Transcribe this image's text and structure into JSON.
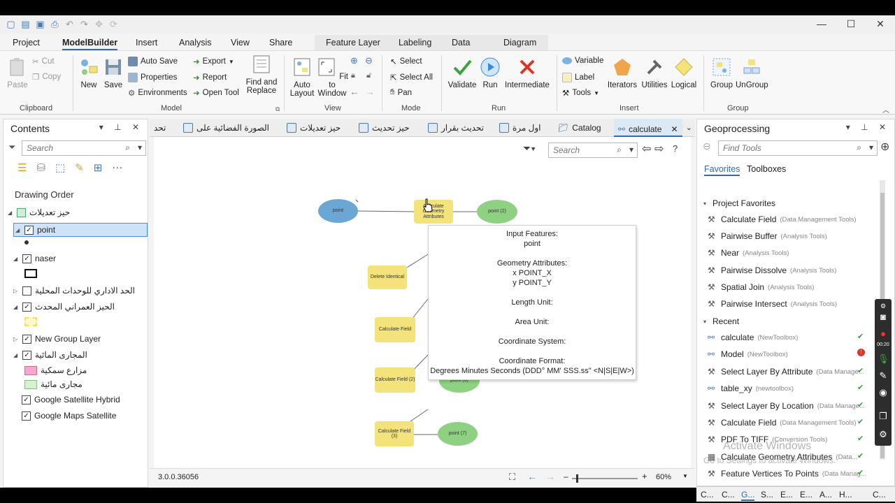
{
  "ribbon_tabs": [
    "Project",
    "ModelBuilder",
    "Insert",
    "Analysis",
    "View",
    "Share",
    "Feature Layer",
    "Labeling",
    "Data",
    "Diagram"
  ],
  "ribbon": {
    "clipboard": {
      "label": "Clipboard",
      "paste": "Paste",
      "cut": "Cut",
      "copy": "Copy"
    },
    "model": {
      "label": "Model",
      "new": "New",
      "save": "Save",
      "auto_save": "Auto Save",
      "properties": "Properties",
      "environments": "Environments",
      "export": "Export",
      "report": "Report",
      "open_tool": "Open Tool",
      "find_replace": "Find and Replace"
    },
    "view": {
      "label": "View",
      "auto_layout": "Auto Layout",
      "fit_to_window": "Fit to Window"
    },
    "mode": {
      "label": "Mode",
      "select": "Select",
      "select_all": "Select All",
      "pan": "Pan"
    },
    "run": {
      "label": "Run",
      "validate": "Validate",
      "run": "Run",
      "intermediate": "Intermediate"
    },
    "insert": {
      "label": "Insert",
      "variable": "Variable",
      "label_btn": "Label",
      "tools": "Tools",
      "iterators": "Iterators",
      "utilities": "Utilities",
      "logical": "Logical"
    },
    "group": {
      "label": "Group",
      "group": "Group",
      "ungroup": "UnGroup"
    }
  },
  "contents": {
    "title": "Contents",
    "search_placeholder": "Search",
    "drawing_order": "Drawing Order",
    "layers": [
      {
        "name": "حيز تعديلات",
        "checked": true
      },
      {
        "name": "point",
        "checked": true
      },
      {
        "name": "naser",
        "checked": true
      },
      {
        "name": "الحد الاداري للوحدات المحلية",
        "checked": false
      },
      {
        "name": "الحيز العمراني المحدث",
        "checked": true
      },
      {
        "name": "New Group Layer",
        "checked": true
      },
      {
        "name": "المجارى المائية",
        "checked": true
      },
      {
        "name": "مزارع سمكية",
        "checked": false
      },
      {
        "name": "مجارى مائية",
        "checked": false
      },
      {
        "name": "Google Satellite Hybrid",
        "checked": true
      },
      {
        "name": "Google Maps Satellite",
        "checked": true
      }
    ]
  },
  "view_tabs": [
    "تحد",
    "الصورة الفضائية على",
    "حيز تعديلات",
    "حيز تحديث",
    "تحديث بقرار",
    "اول مرة",
    "Catalog",
    "calculate"
  ],
  "canvas": {
    "search_placeholder": "Search",
    "nodes": {
      "point": "point",
      "calc_geom": "Calculate Geometry Attributes",
      "point2": "point (2)",
      "delete_identical": "Delete Identical",
      "calc_field": "Calculate Field",
      "calc_field2": "Calculate Field (2)",
      "point6": "point (6)",
      "calc_field3": "Calculate Field (3)",
      "point7": "point (7)"
    },
    "tooltip": {
      "input_features_label": "Input Features:",
      "input_features_value": "point",
      "geometry_label": "Geometry Attributes:",
      "geometry_x": "x POINT_X",
      "geometry_y": "y POINT_Y",
      "length_unit": "Length Unit:",
      "area_unit": "Area Unit:",
      "coord_system": "Coordinate System:",
      "coord_format_label": "Coordinate Format:",
      "coord_format_value": "Degrees Minutes Seconds (DDD° MM' SSS.ss\" <N|S|E|W>)"
    }
  },
  "status": {
    "version": "3.0.0.36056",
    "zoom": "60%"
  },
  "geoprocessing": {
    "title": "Geoprocessing",
    "find_placeholder": "Find Tools",
    "tab_favorites": "Favorites",
    "tab_toolboxes": "Toolboxes",
    "project_favorites": "Project Favorites",
    "favorites": [
      {
        "name": "Calculate Field",
        "sub": "(Data Management Tools)"
      },
      {
        "name": "Pairwise Buffer",
        "sub": "(Analysis Tools)"
      },
      {
        "name": "Near",
        "sub": "(Analysis Tools)"
      },
      {
        "name": "Pairwise Dissolve",
        "sub": "(Analysis Tools)"
      },
      {
        "name": "Spatial Join",
        "sub": "(Analysis Tools)"
      },
      {
        "name": "Pairwise Intersect",
        "sub": "(Analysis Tools)"
      }
    ],
    "recent_label": "Recent",
    "recent": [
      {
        "name": "calculate",
        "sub": "(NewToolbox)",
        "status": "✔"
      },
      {
        "name": "Model",
        "sub": "(NewToolbox)",
        "status": "!"
      },
      {
        "name": "Select Layer By Attribute",
        "sub": "(Data Manage...",
        "status": "✔"
      },
      {
        "name": "table_xy",
        "sub": "(newtoolbox)",
        "status": "✔"
      },
      {
        "name": "Select Layer By Location",
        "sub": "(Data Manage...",
        "status": "✔"
      },
      {
        "name": "Calculate Field",
        "sub": "(Data Management Tools)",
        "status": "✔"
      },
      {
        "name": "PDF To TIFF",
        "sub": "(Conversion Tools)",
        "status": "✔"
      },
      {
        "name": "Calculate Geometry Attributes",
        "sub": "(Data...",
        "status": "✔"
      },
      {
        "name": "Feature Vertices To Points",
        "sub": "(Data Manag...",
        "status": "✔"
      }
    ],
    "watermark_1": "Activate Windows",
    "watermark_2": "Go to Settings to activate Windows.",
    "bottom_tabs": [
      "C...",
      "C...",
      "G...",
      "S...",
      "E...",
      "E...",
      "A...",
      "H...",
      "C..."
    ]
  },
  "recorder_time": "00:20",
  "colors": {
    "accent": "#2b6cb8",
    "node_blue": "#6aa7d5",
    "node_green": "#8fd183",
    "node_yellow": "#f3e37a"
  }
}
